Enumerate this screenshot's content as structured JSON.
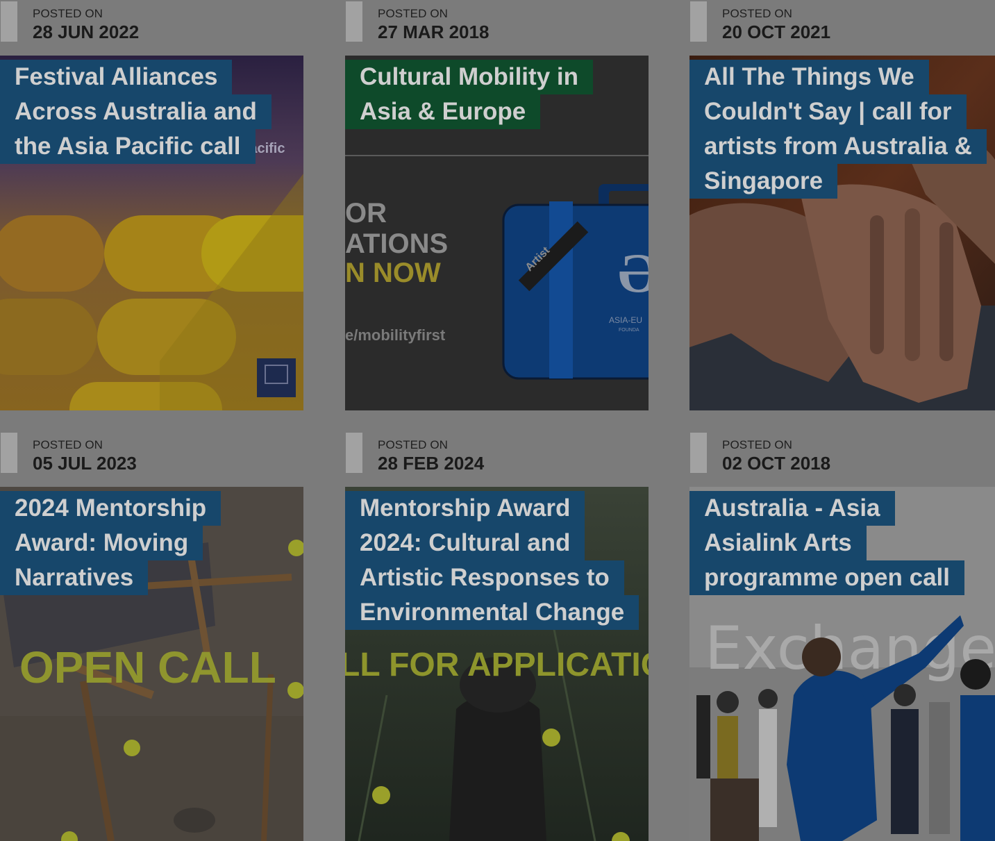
{
  "colors": {
    "overlay_bg": "#7b7b7b",
    "title_blue": "#17476b",
    "title_green": "#0e4a2a",
    "title_text": "#cfcfcf"
  },
  "posts": [
    {
      "posted_label": "POSTED ON",
      "date": "28 JUN 2022",
      "title_lines": [
        "Festival Alliances",
        "Across Australia and",
        "the Asia Pacific call"
      ],
      "title_color": "blue",
      "image_text": "Pacific"
    },
    {
      "posted_label": "POSTED ON",
      "date": "27 MAR 2018",
      "title_lines": [
        "Cultural Mobility in",
        "Asia & Europe"
      ],
      "title_color": "green",
      "image_text_lines": [
        "OR",
        "ATIONS",
        "N NOW",
        "e/mobilityfirst",
        "Artist",
        "ASIA-EU",
        "FOUNDA"
      ]
    },
    {
      "posted_label": "POSTED ON",
      "date": "20 OCT 2021",
      "title_lines": [
        "All The Things We",
        "Couldn't Say | call for",
        "artists from Australia &",
        "Singapore"
      ],
      "title_color": "blue"
    },
    {
      "posted_label": "POSTED ON",
      "date": "05 JUL 2023",
      "title_lines": [
        "2024 Mentorship",
        "Award: Moving",
        "Narratives"
      ],
      "title_color": "blue",
      "image_text": "OPEN CALL"
    },
    {
      "posted_label": "POSTED ON",
      "date": "28 FEB 2024",
      "title_lines": [
        "Mentorship Award",
        "2024: Cultural and",
        "Artistic Responses to",
        "Environmental Change"
      ],
      "title_color": "blue",
      "image_text": "LL FOR APPLICATIC"
    },
    {
      "posted_label": "POSTED ON",
      "date": "02 OCT 2018",
      "title_lines": [
        "Australia - Asia",
        "Asialink Arts",
        "programme open call"
      ],
      "title_color": "blue",
      "image_text": "Exchanges"
    }
  ]
}
